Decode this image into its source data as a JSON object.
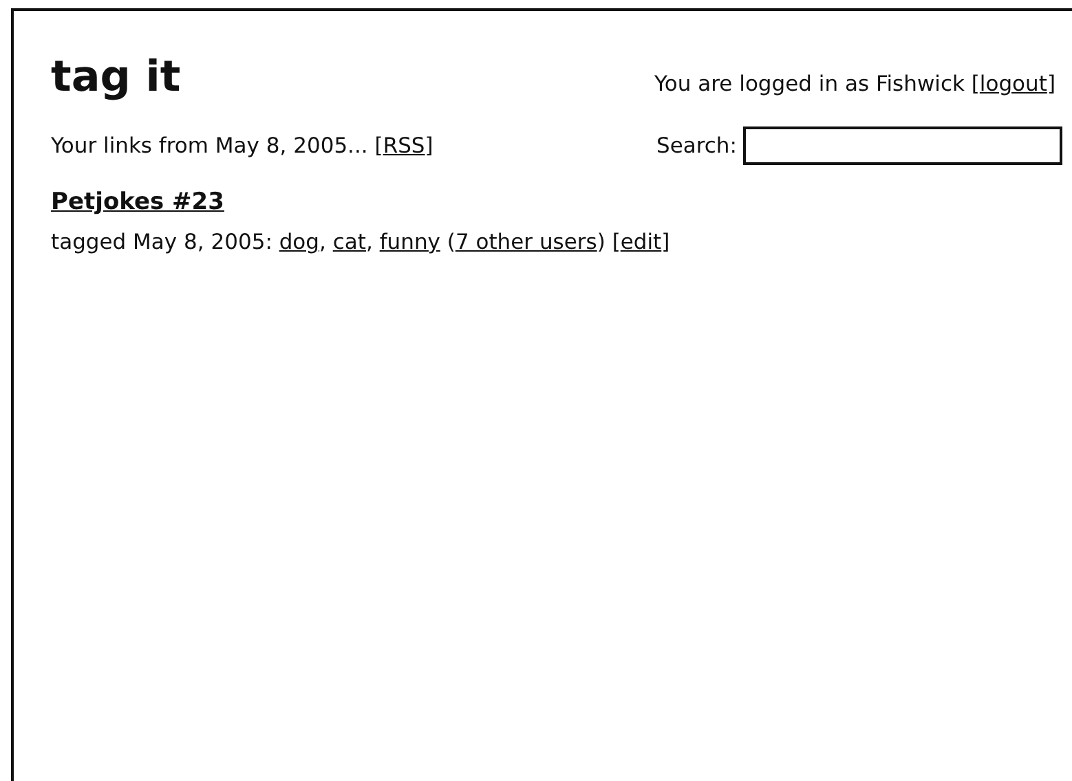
{
  "header": {
    "title": "tag it",
    "login": [
      {
        "kind": "text",
        "text": "You are logged in as Fishwick ["
      },
      {
        "kind": "link",
        "text": "logout"
      },
      {
        "kind": "text",
        "text": "]"
      }
    ]
  },
  "links_line": [
    {
      "kind": "text",
      "text": "Your links from May 8, 2005... ["
    },
    {
      "kind": "link",
      "text": "RSS"
    },
    {
      "kind": "text",
      "text": "]"
    }
  ],
  "search": {
    "label": "Search:"
  },
  "entries": [
    {
      "title": "Petjokes #23",
      "tags_line": [
        {
          "kind": "text",
          "text": "tagged May 8, 2005: "
        },
        {
          "kind": "link",
          "text": "dog"
        },
        {
          "kind": "text",
          "text": ", "
        },
        {
          "kind": "link",
          "text": "cat"
        },
        {
          "kind": "text",
          "text": ", "
        },
        {
          "kind": "link",
          "text": "funny"
        },
        {
          "kind": "text",
          "text": " ("
        },
        {
          "kind": "link",
          "text": "7 other users"
        },
        {
          "kind": "text",
          "text": ") ["
        },
        {
          "kind": "link",
          "text": "edit"
        },
        {
          "kind": "text",
          "text": "]"
        }
      ]
    }
  ]
}
